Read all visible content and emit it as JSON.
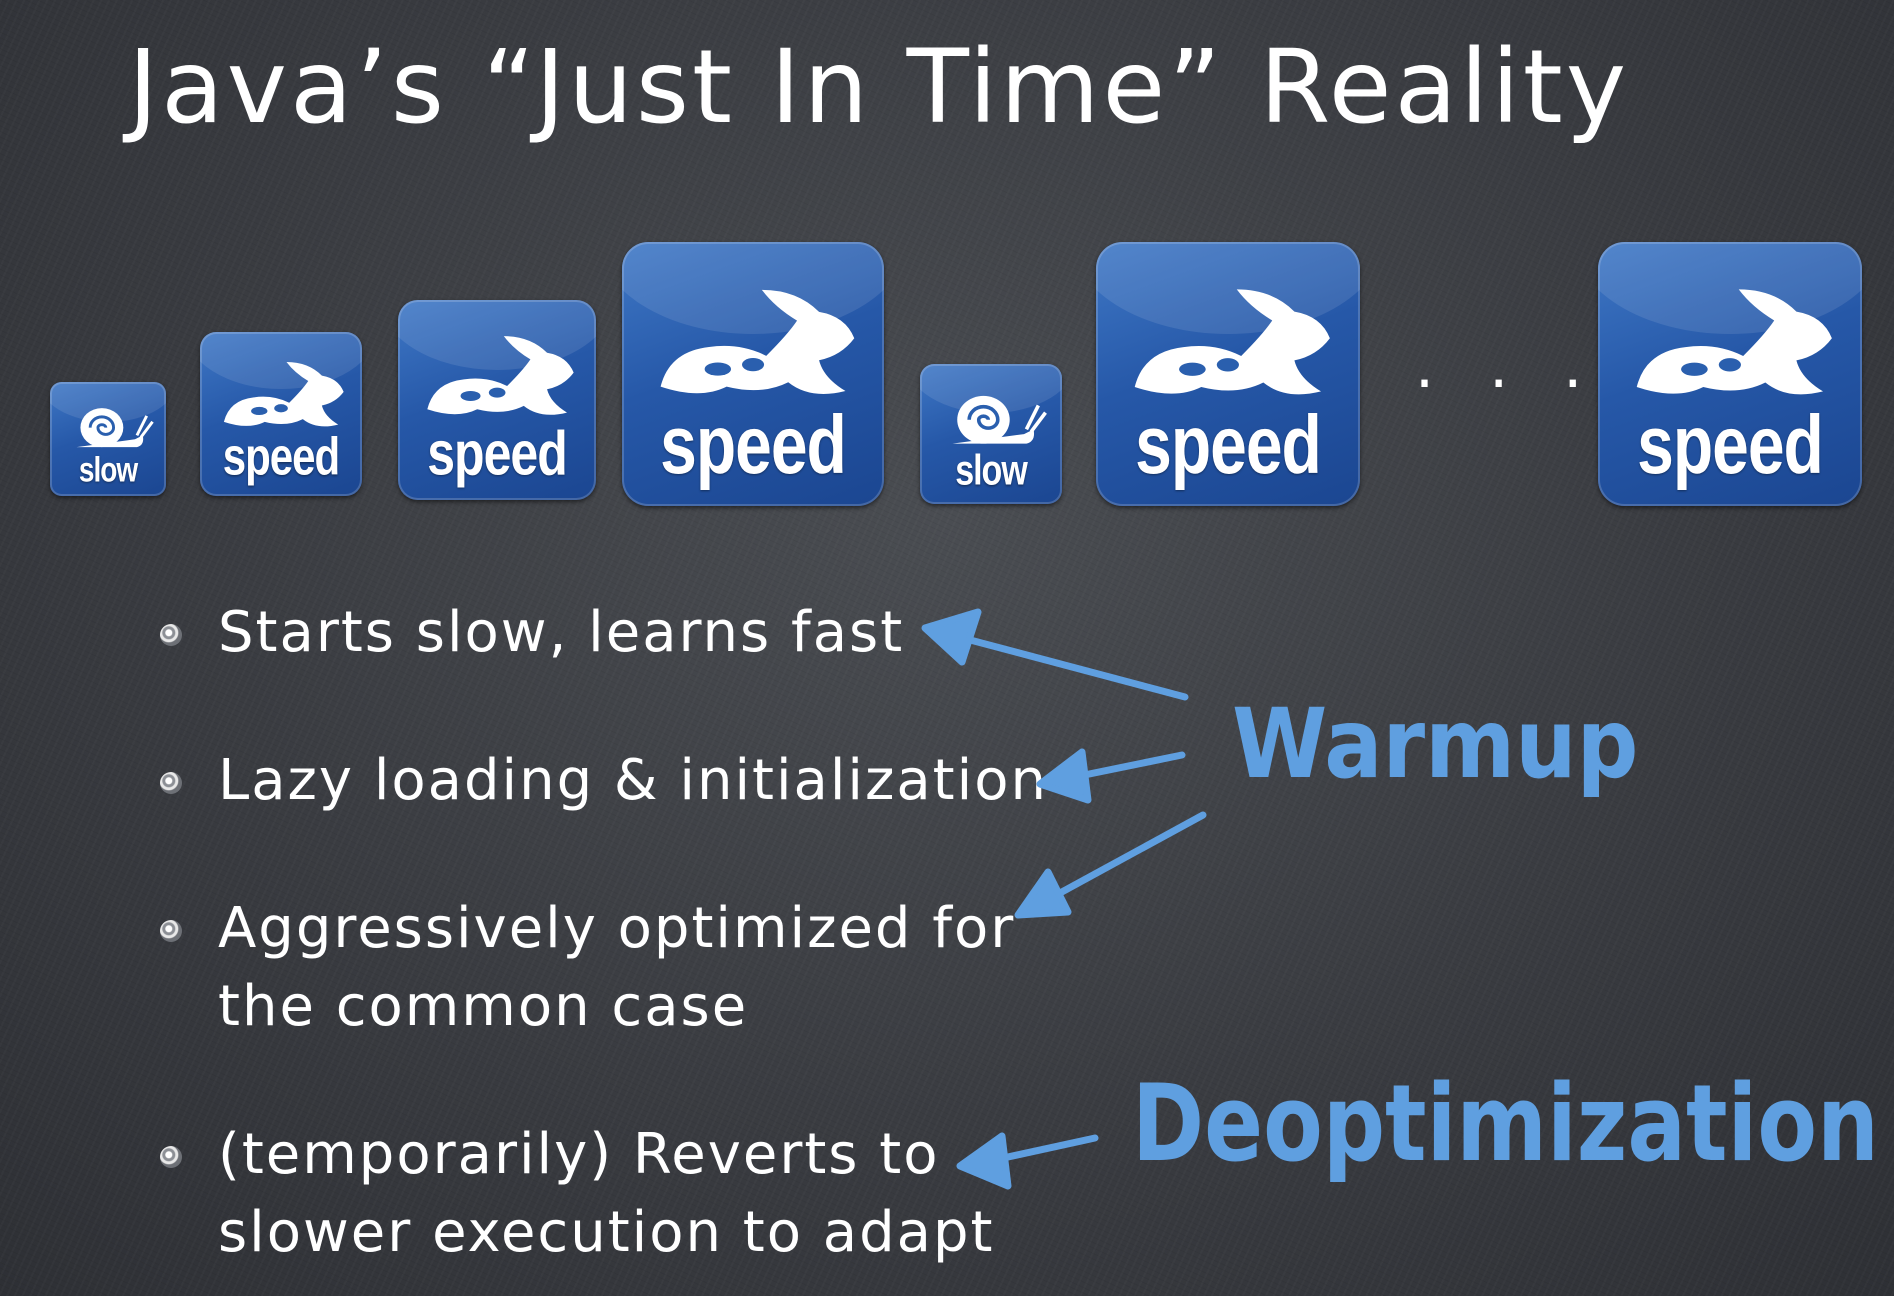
{
  "slide": {
    "title": "Java’s “Just In Time” Reality",
    "icons": [
      {
        "kind": "slow",
        "label": "slow"
      },
      {
        "kind": "speed",
        "label": "speed"
      },
      {
        "kind": "speed",
        "label": "speed"
      },
      {
        "kind": "speed",
        "label": "speed"
      },
      {
        "kind": "slow",
        "label": "slow"
      },
      {
        "kind": "speed",
        "label": "speed"
      },
      {
        "kind": "speed",
        "label": "speed"
      }
    ],
    "ellipsis": ". . .",
    "bullets": [
      {
        "lines": [
          "Starts slow, learns fast"
        ]
      },
      {
        "lines": [
          "Lazy loading & initialization"
        ]
      },
      {
        "lines": [
          "Aggressively optimized for",
          "the common case"
        ]
      },
      {
        "lines": [
          "(temporarily) Reverts to",
          "slower execution to adapt"
        ]
      }
    ],
    "tags": {
      "warmup": "Warmup",
      "deoptimization": "Deoptimization"
    },
    "colors": {
      "accent": "#5f9fe0",
      "icon_blue": "#2658a8",
      "text": "#ffffff",
      "background": "#3a3c41"
    },
    "icon_glyphs": {
      "slow": "snail-icon",
      "speed": "rabbit-icon"
    }
  }
}
